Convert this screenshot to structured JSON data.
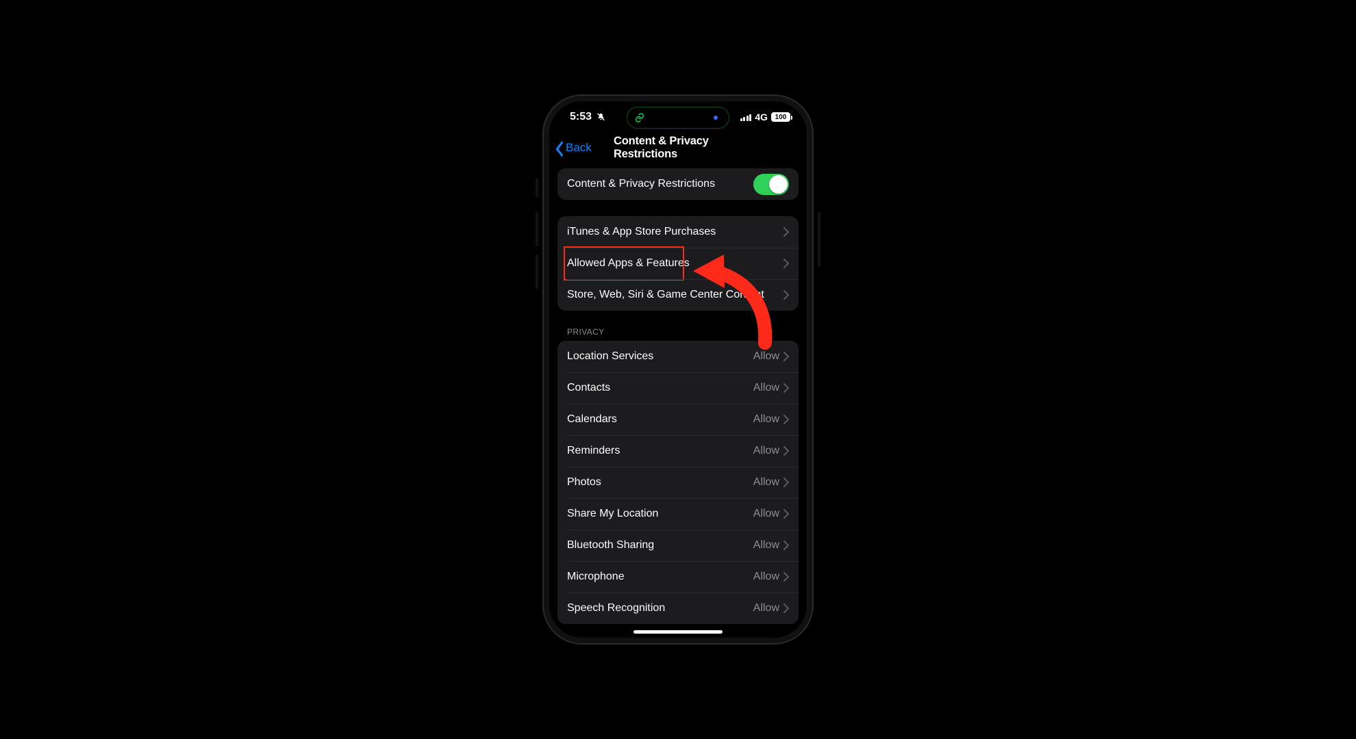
{
  "status_bar": {
    "time": "5:53",
    "silent": true,
    "network_type": "4G",
    "battery_pct": "100"
  },
  "nav": {
    "back_label": "Back",
    "title": "Content & Privacy Restrictions"
  },
  "toggle_row": {
    "label": "Content & Privacy Restrictions",
    "on": true
  },
  "main_group": [
    {
      "label": "iTunes & App Store Purchases"
    },
    {
      "label": "Allowed Apps & Features"
    },
    {
      "label": "Store, Web, Siri & Game Center Content"
    }
  ],
  "privacy_header": "PRIVACY",
  "privacy_group": [
    {
      "label": "Location Services",
      "value": "Allow"
    },
    {
      "label": "Contacts",
      "value": "Allow"
    },
    {
      "label": "Calendars",
      "value": "Allow"
    },
    {
      "label": "Reminders",
      "value": "Allow"
    },
    {
      "label": "Photos",
      "value": "Allow"
    },
    {
      "label": "Share My Location",
      "value": "Allow"
    },
    {
      "label": "Bluetooth Sharing",
      "value": "Allow"
    },
    {
      "label": "Microphone",
      "value": "Allow"
    },
    {
      "label": "Speech Recognition",
      "value": "Allow"
    }
  ],
  "annotation": {
    "highlighted_row_index": 1,
    "colors": {
      "accent_blue": "#0a84ff",
      "toggle_green": "#30d158",
      "highlight_red": "#ff2a1a",
      "arrow_red": "#ff2a1a"
    }
  }
}
